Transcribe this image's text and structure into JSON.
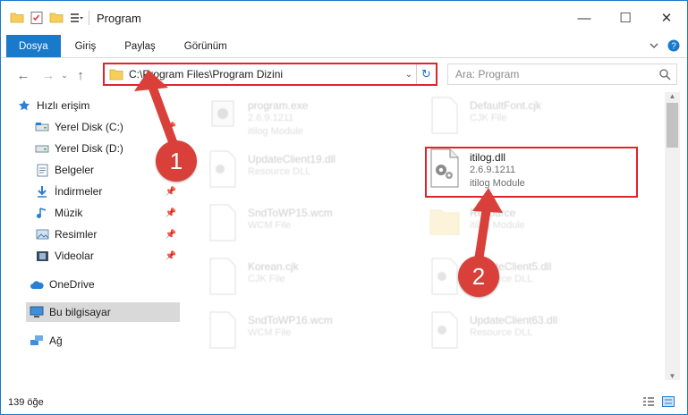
{
  "window": {
    "title": "Program",
    "controls": {
      "minimize": "—",
      "maximize": "☐",
      "close": "✕"
    }
  },
  "ribbon": {
    "tabs": [
      {
        "label": "Dosya",
        "active": true
      },
      {
        "label": "Giriş",
        "active": false
      },
      {
        "label": "Paylaş",
        "active": false
      },
      {
        "label": "Görünüm",
        "active": false
      }
    ]
  },
  "address": {
    "path": "C:\\Program Files\\Program Dizini",
    "search_placeholder": "Ara: Program"
  },
  "nav": {
    "items": [
      {
        "label": "Hızlı erişim",
        "icon": "star-icon",
        "pinned": false
      },
      {
        "label": "Yerel Disk (C:)",
        "icon": "drive-icon",
        "pinned": true
      },
      {
        "label": "Yerel Disk (D:)",
        "icon": "drive-icon",
        "pinned": true
      },
      {
        "label": "Belgeler",
        "icon": "documents-icon",
        "pinned": true
      },
      {
        "label": "İndirmeler",
        "icon": "download-icon",
        "pinned": true
      },
      {
        "label": "Müzik",
        "icon": "music-icon",
        "pinned": true
      },
      {
        "label": "Resimler",
        "icon": "pictures-icon",
        "pinned": true
      },
      {
        "label": "Videolar",
        "icon": "videos-icon",
        "pinned": true
      },
      {
        "label": "OneDrive",
        "icon": "cloud-icon",
        "pinned": false
      },
      {
        "label": "Bu bilgisayar",
        "icon": "computer-icon",
        "pinned": false,
        "selected": true
      },
      {
        "label": "Ağ",
        "icon": "network-icon",
        "pinned": false
      }
    ]
  },
  "files": [
    {
      "name": "program.exe",
      "line2": "2.6.9.1211",
      "line3": "itilog Module",
      "icon": "exe-icon",
      "faded": true
    },
    {
      "name": "DefaultFont.cjk",
      "line2": "CJK File",
      "line3": "",
      "icon": "file-icon",
      "faded": true
    },
    {
      "name": "UpdateClient19.dll",
      "line2": "Resource DLL",
      "line3": "",
      "icon": "dll-icon",
      "faded": true
    },
    {
      "name": "itilog.dll",
      "line2": "2.6.9.1211",
      "line3": "itilog Module",
      "icon": "dll-icon",
      "faded": false
    },
    {
      "name": "SndToWP15.wcm",
      "line2": "WCM File",
      "line3": "",
      "icon": "file-icon",
      "faded": true
    },
    {
      "name": "Resource",
      "line2": "",
      "line3": "itilog Module",
      "icon": "folder-icon",
      "faded": true
    },
    {
      "name": "Korean.cjk",
      "line2": "CJK File",
      "line3": "",
      "icon": "file-icon",
      "faded": true
    },
    {
      "name": "UpdateClient5.dll",
      "line2": "Resource DLL",
      "line3": "",
      "icon": "dll-icon",
      "faded": true
    },
    {
      "name": "SndToWP16.wcm",
      "line2": "WCM File",
      "line3": "",
      "icon": "file-icon",
      "faded": true
    },
    {
      "name": "UpdateClient63.dll",
      "line2": "Resource DLL",
      "line3": "",
      "icon": "dll-icon",
      "faded": true
    }
  ],
  "status": {
    "item_count": "139 öğe"
  },
  "callouts": {
    "one": "1",
    "two": "2"
  },
  "colors": {
    "accent": "#1979ca",
    "highlight": "#e0242a",
    "callout": "#d9403a"
  }
}
